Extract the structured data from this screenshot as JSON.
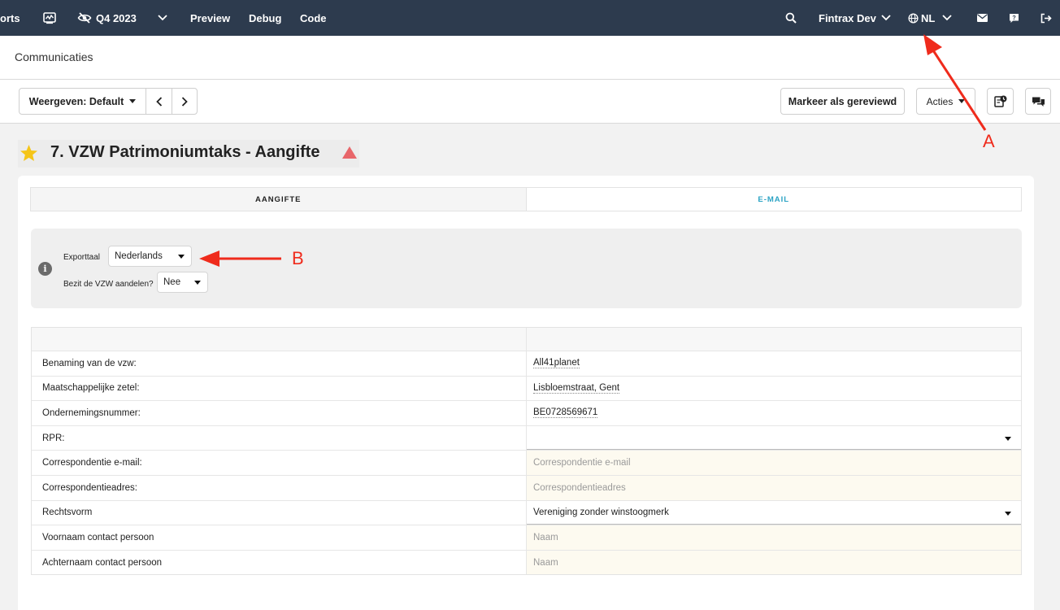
{
  "topbar": {
    "reports_label": "orts",
    "period_label": "Q4 2023",
    "preview_label": "Preview",
    "debug_label": "Debug",
    "code_label": "Code",
    "company_label": "Fintrax Dev",
    "language_label": "NL"
  },
  "page": {
    "title": "Communicaties"
  },
  "toolbar": {
    "view_label": "Weergeven: Default",
    "mark_reviewed_label": "Markeer als gereviewd",
    "actions_label": "Acties"
  },
  "heading": {
    "text": "7. VZW Patrimoniumtaks - Aangifte"
  },
  "tabs": [
    {
      "label": "AANGIFTE",
      "active": true
    },
    {
      "label": "E-MAIL",
      "active": false
    }
  ],
  "options": {
    "export_label": "Exporttaal",
    "export_value": "Nederlands",
    "shares_label": "Bezit de VZW aandelen?",
    "shares_value": "Nee"
  },
  "table": {
    "rows": [
      {
        "label": "Benaming van de vzw:",
        "value": "All41planet",
        "kind": "filled"
      },
      {
        "label": "Maatschappelijke zetel:",
        "value": "Lisbloemstraat, Gent",
        "kind": "filled"
      },
      {
        "label": "Ondernemingsnummer:",
        "value": "BE0728569671",
        "kind": "filled"
      },
      {
        "label": "RPR:",
        "value": "",
        "kind": "dropdown"
      },
      {
        "label": "Correspondentie e-mail:",
        "value": "Correspondentie e-mail",
        "kind": "placeholder"
      },
      {
        "label": "Correspondentieadres:",
        "value": "Correspondentieadres",
        "kind": "placeholder"
      },
      {
        "label": "Rechtsvorm",
        "value": "Vereniging zonder winstoogmerk",
        "kind": "dropdown"
      },
      {
        "label": "Voornaam contact persoon",
        "value": "Naam",
        "kind": "placeholder"
      },
      {
        "label": "Achternaam contact persoon",
        "value": "Naam",
        "kind": "placeholder"
      }
    ]
  },
  "annotations": {
    "a_label": "A",
    "b_label": "B"
  },
  "colors": {
    "topbar": "#2d3b4e",
    "accent": "#2ba3c4",
    "annotation": "#ef2b1c",
    "star": "#f5c518",
    "warning": "#e8666a"
  }
}
